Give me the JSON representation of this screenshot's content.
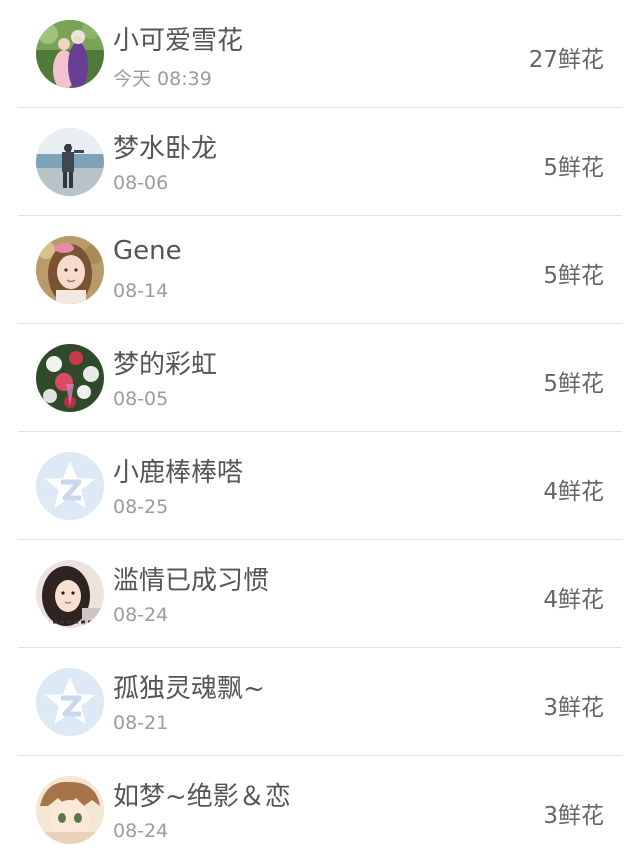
{
  "flower_list": {
    "items": [
      {
        "name": "小可爱雪花",
        "time": "今天 08:39",
        "count": "27鲜花",
        "avatar_icon": "couple-photo-avatar"
      },
      {
        "name": "梦水卧龙",
        "time": "08-06",
        "count": "5鲜花",
        "avatar_icon": "beach-person-avatar"
      },
      {
        "name": "Gene",
        "time": "08-14",
        "count": "5鲜花",
        "avatar_icon": "girl-portrait-avatar"
      },
      {
        "name": "梦的彩虹",
        "time": "08-05",
        "count": "5鲜花",
        "avatar_icon": "flower-bouquet-avatar"
      },
      {
        "name": "小鹿棒棒嗒",
        "time": "08-25",
        "count": "4鲜花",
        "avatar_icon": "default-qzone-star-avatar"
      },
      {
        "name": "滥情已成习惯",
        "time": "08-24",
        "count": "4鲜花",
        "avatar_icon": "girl-selfie-avatar"
      },
      {
        "name": "孤独灵魂飘~",
        "time": "08-21",
        "count": "3鲜花",
        "avatar_icon": "default-qzone-star-avatar"
      },
      {
        "name": "如梦~绝影＆恋",
        "time": "08-24",
        "count": "3鲜花",
        "avatar_icon": "anime-character-avatar"
      }
    ]
  }
}
